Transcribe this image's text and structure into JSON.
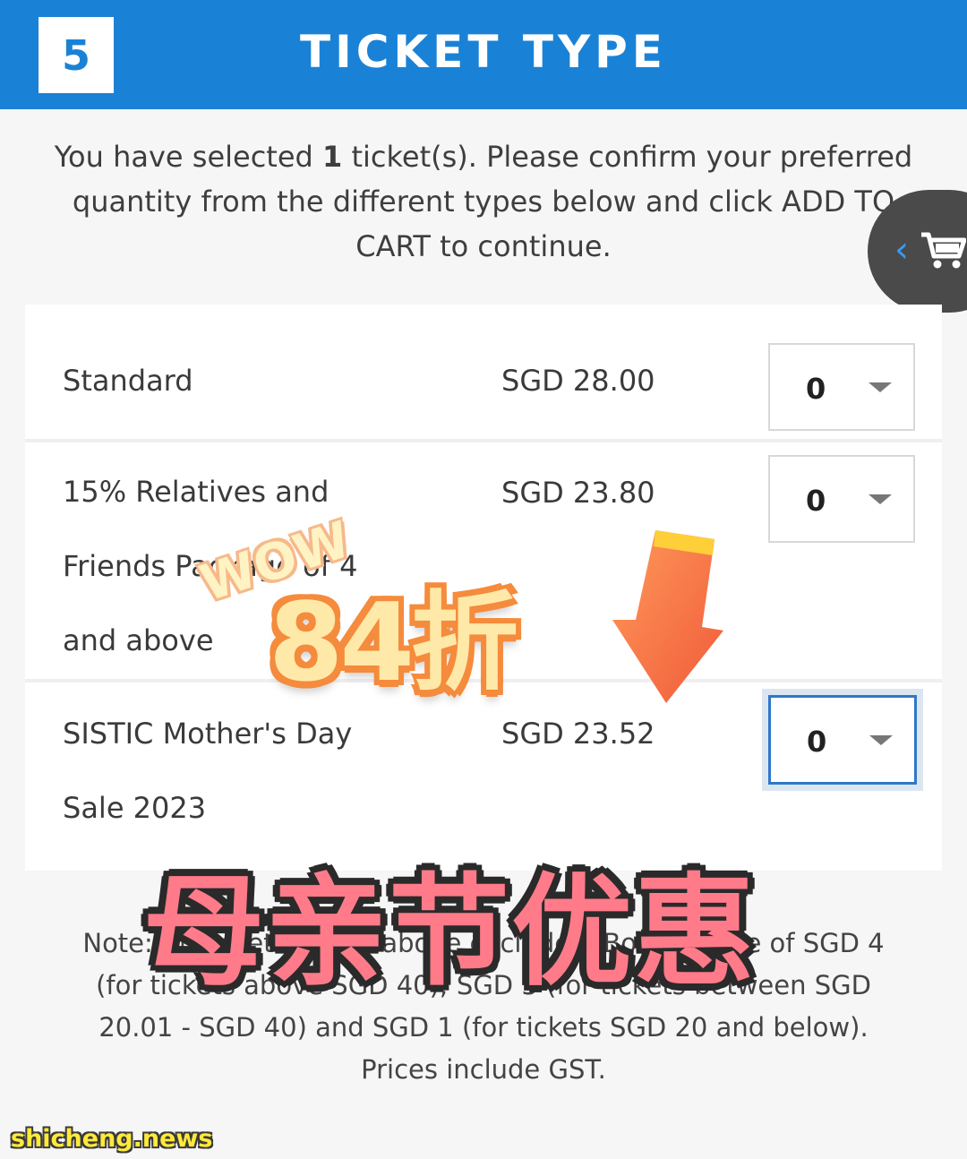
{
  "header": {
    "step_number": "5",
    "title": "TICKET TYPE"
  },
  "intro": {
    "before": "You have selected ",
    "count": "1",
    "after": " ticket(s). Please confirm your preferred quantity from the different types below and click ADD TO CART to continue."
  },
  "cart": {
    "chevron": "‹"
  },
  "tickets": [
    {
      "name_lines": [
        "Standard"
      ],
      "price": "SGD 28.00",
      "qty": "0"
    },
    {
      "name_lines": [
        "15% Relatives and",
        "Friends Package of 4",
        "and above"
      ],
      "price": "SGD 23.80",
      "qty": "0"
    },
    {
      "name_lines": [
        "SISTIC Mother's Day",
        "Sale 2023"
      ],
      "price": "SGD 23.52",
      "qty": "0"
    }
  ],
  "note": "Note: All tickets prices above exclude a Booking Fee of SGD 4 (for tickets above SGD 40); SGD 3 (for tickets between SGD 20.01 - SGD 40) and SGD 1 (for tickets SGD 20 and below). Prices include GST.",
  "overlay": {
    "wow": "WOW",
    "discount": "84折",
    "banner": "母亲节优惠"
  },
  "watermark": "shicheng.news",
  "colors": {
    "header_blue": "#1a82d6",
    "active_border": "#2f78c8"
  },
  "icons": [
    "chevron-left-icon",
    "shopping-cart-icon",
    "dropdown-caret-icon",
    "down-arrow-icon"
  ]
}
